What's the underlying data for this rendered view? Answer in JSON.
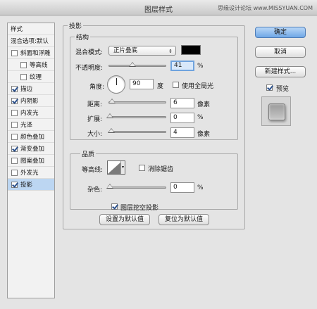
{
  "window": {
    "title": "图层样式",
    "watermark": "思缘设计论坛 www.MISSYUAN.COM"
  },
  "styles_list": {
    "header": "样式",
    "blend_options": "混合选项:默认",
    "items": [
      {
        "label": "斜面和浮雕",
        "checked": false
      },
      {
        "label": "等高线",
        "checked": false
      },
      {
        "label": "纹理",
        "checked": false
      },
      {
        "label": "描边",
        "checked": true
      },
      {
        "label": "内阴影",
        "checked": true
      },
      {
        "label": "内发光",
        "checked": false
      },
      {
        "label": "光泽",
        "checked": false
      },
      {
        "label": "颜色叠加",
        "checked": false
      },
      {
        "label": "渐变叠加",
        "checked": true
      },
      {
        "label": "图案叠加",
        "checked": false
      },
      {
        "label": "外发光",
        "checked": false
      },
      {
        "label": "投影",
        "checked": true
      }
    ]
  },
  "drop_shadow": {
    "section_title": "投影",
    "structure": {
      "title": "结构",
      "blend_mode_label": "混合模式:",
      "blend_mode_value": "正片叠底",
      "shadow_color": "#000000",
      "opacity_label": "不透明度:",
      "opacity_value": "41",
      "percent_unit": "%",
      "angle_label": "角度:",
      "angle_value": "90",
      "angle_unit": "度",
      "global_light_label": "使用全局光",
      "distance_label": "距离:",
      "distance_value": "6",
      "spread_label": "扩展:",
      "spread_value": "0",
      "size_label": "大小:",
      "size_value": "4",
      "pixel_unit": "像素"
    },
    "quality": {
      "title": "品质",
      "contour_label": "等高线:",
      "antialias_label": "消除锯齿",
      "noise_label": "杂色:",
      "noise_value": "0",
      "percent_unit": "%"
    },
    "knockout_label": "图层挖空投影",
    "make_default": "设置为默认值",
    "reset_default": "复位为默认值"
  },
  "actions": {
    "ok": "确定",
    "cancel": "取消",
    "new_style": "新建样式...",
    "preview_label": "预览"
  }
}
